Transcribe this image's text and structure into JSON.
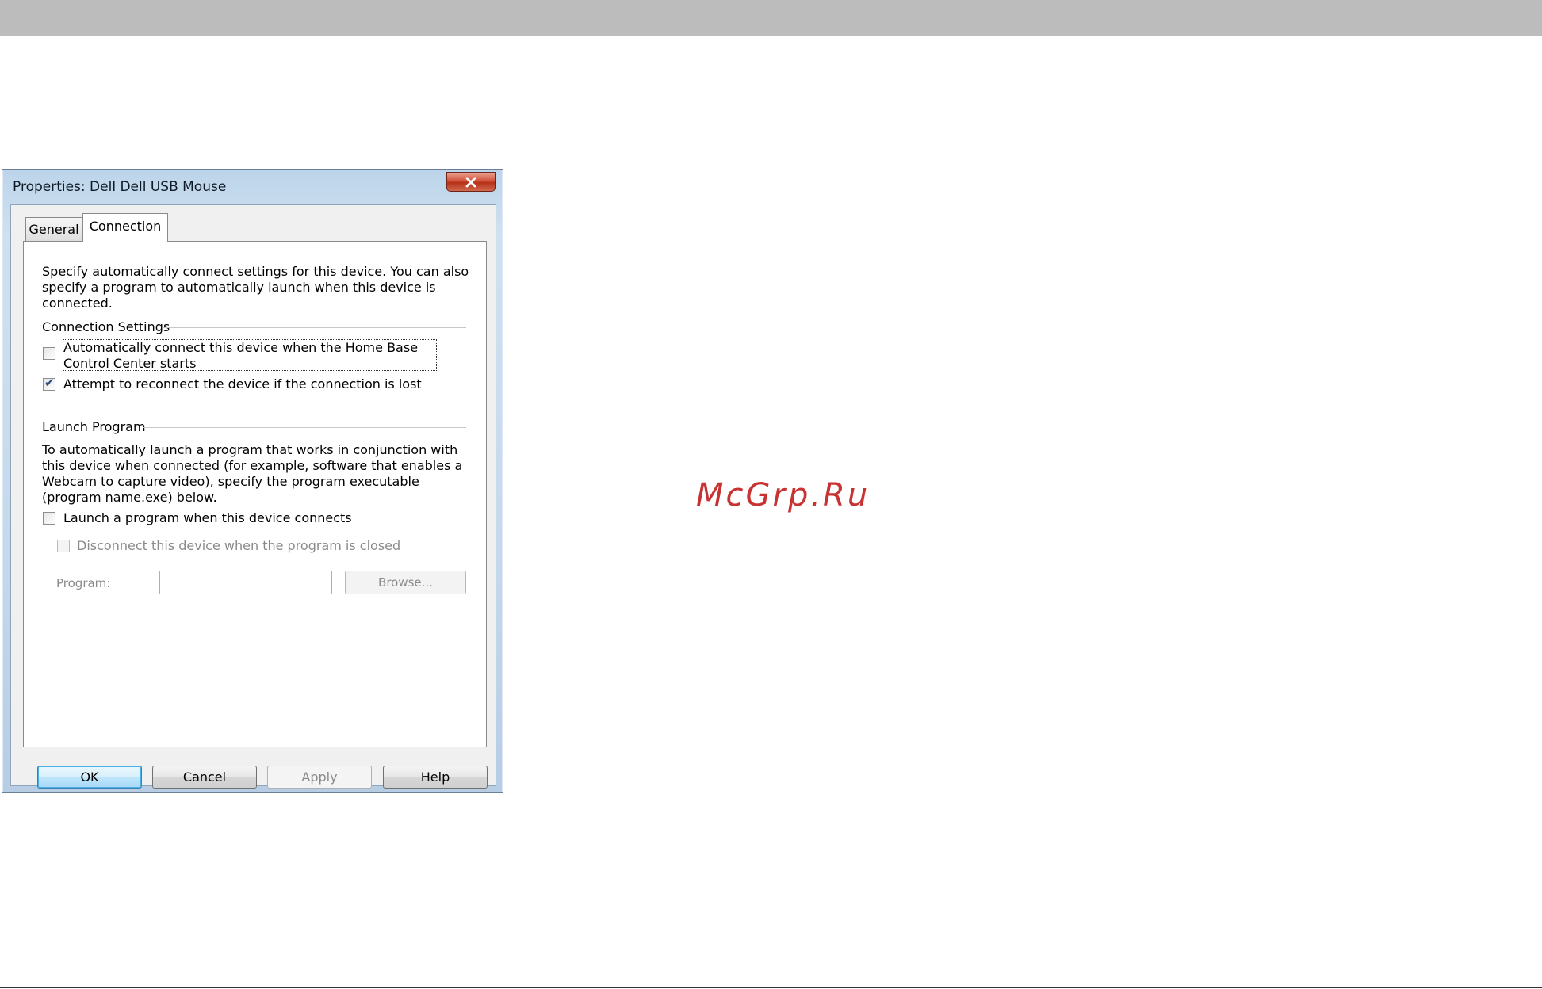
{
  "dialog": {
    "title": "Properties: Dell Dell USB Mouse",
    "tabs": [
      {
        "label": "General"
      },
      {
        "label": "Connection"
      }
    ],
    "description": "Specify automatically connect settings for this device. You can also specify a program to automatically launch when this device is connected.",
    "connection_settings": {
      "heading": "Connection Settings",
      "auto_connect": {
        "label": "Automatically connect this device when the Home Base Control Center starts",
        "checked": false
      },
      "reconnect": {
        "label": "Attempt to reconnect the device if the connection is lost",
        "checked": true
      }
    },
    "launch_program": {
      "heading": "Launch Program",
      "description": "To automatically launch a program that works in conjunction with this device when connected (for example, software that enables a Webcam to capture video), specify the program executable (program name.exe) below.",
      "launch_on_connect": {
        "label": "Launch a program when this device connects",
        "checked": false
      },
      "disconnect_on_close": {
        "label": "Disconnect this device when the program is closed",
        "checked": false,
        "enabled": false
      },
      "program_label": "Program:",
      "program_value": "",
      "browse_label": "Browse..."
    },
    "buttons": {
      "ok": "OK",
      "cancel": "Cancel",
      "apply": "Apply",
      "help": "Help"
    }
  },
  "watermark": "McGrp.Ru"
}
